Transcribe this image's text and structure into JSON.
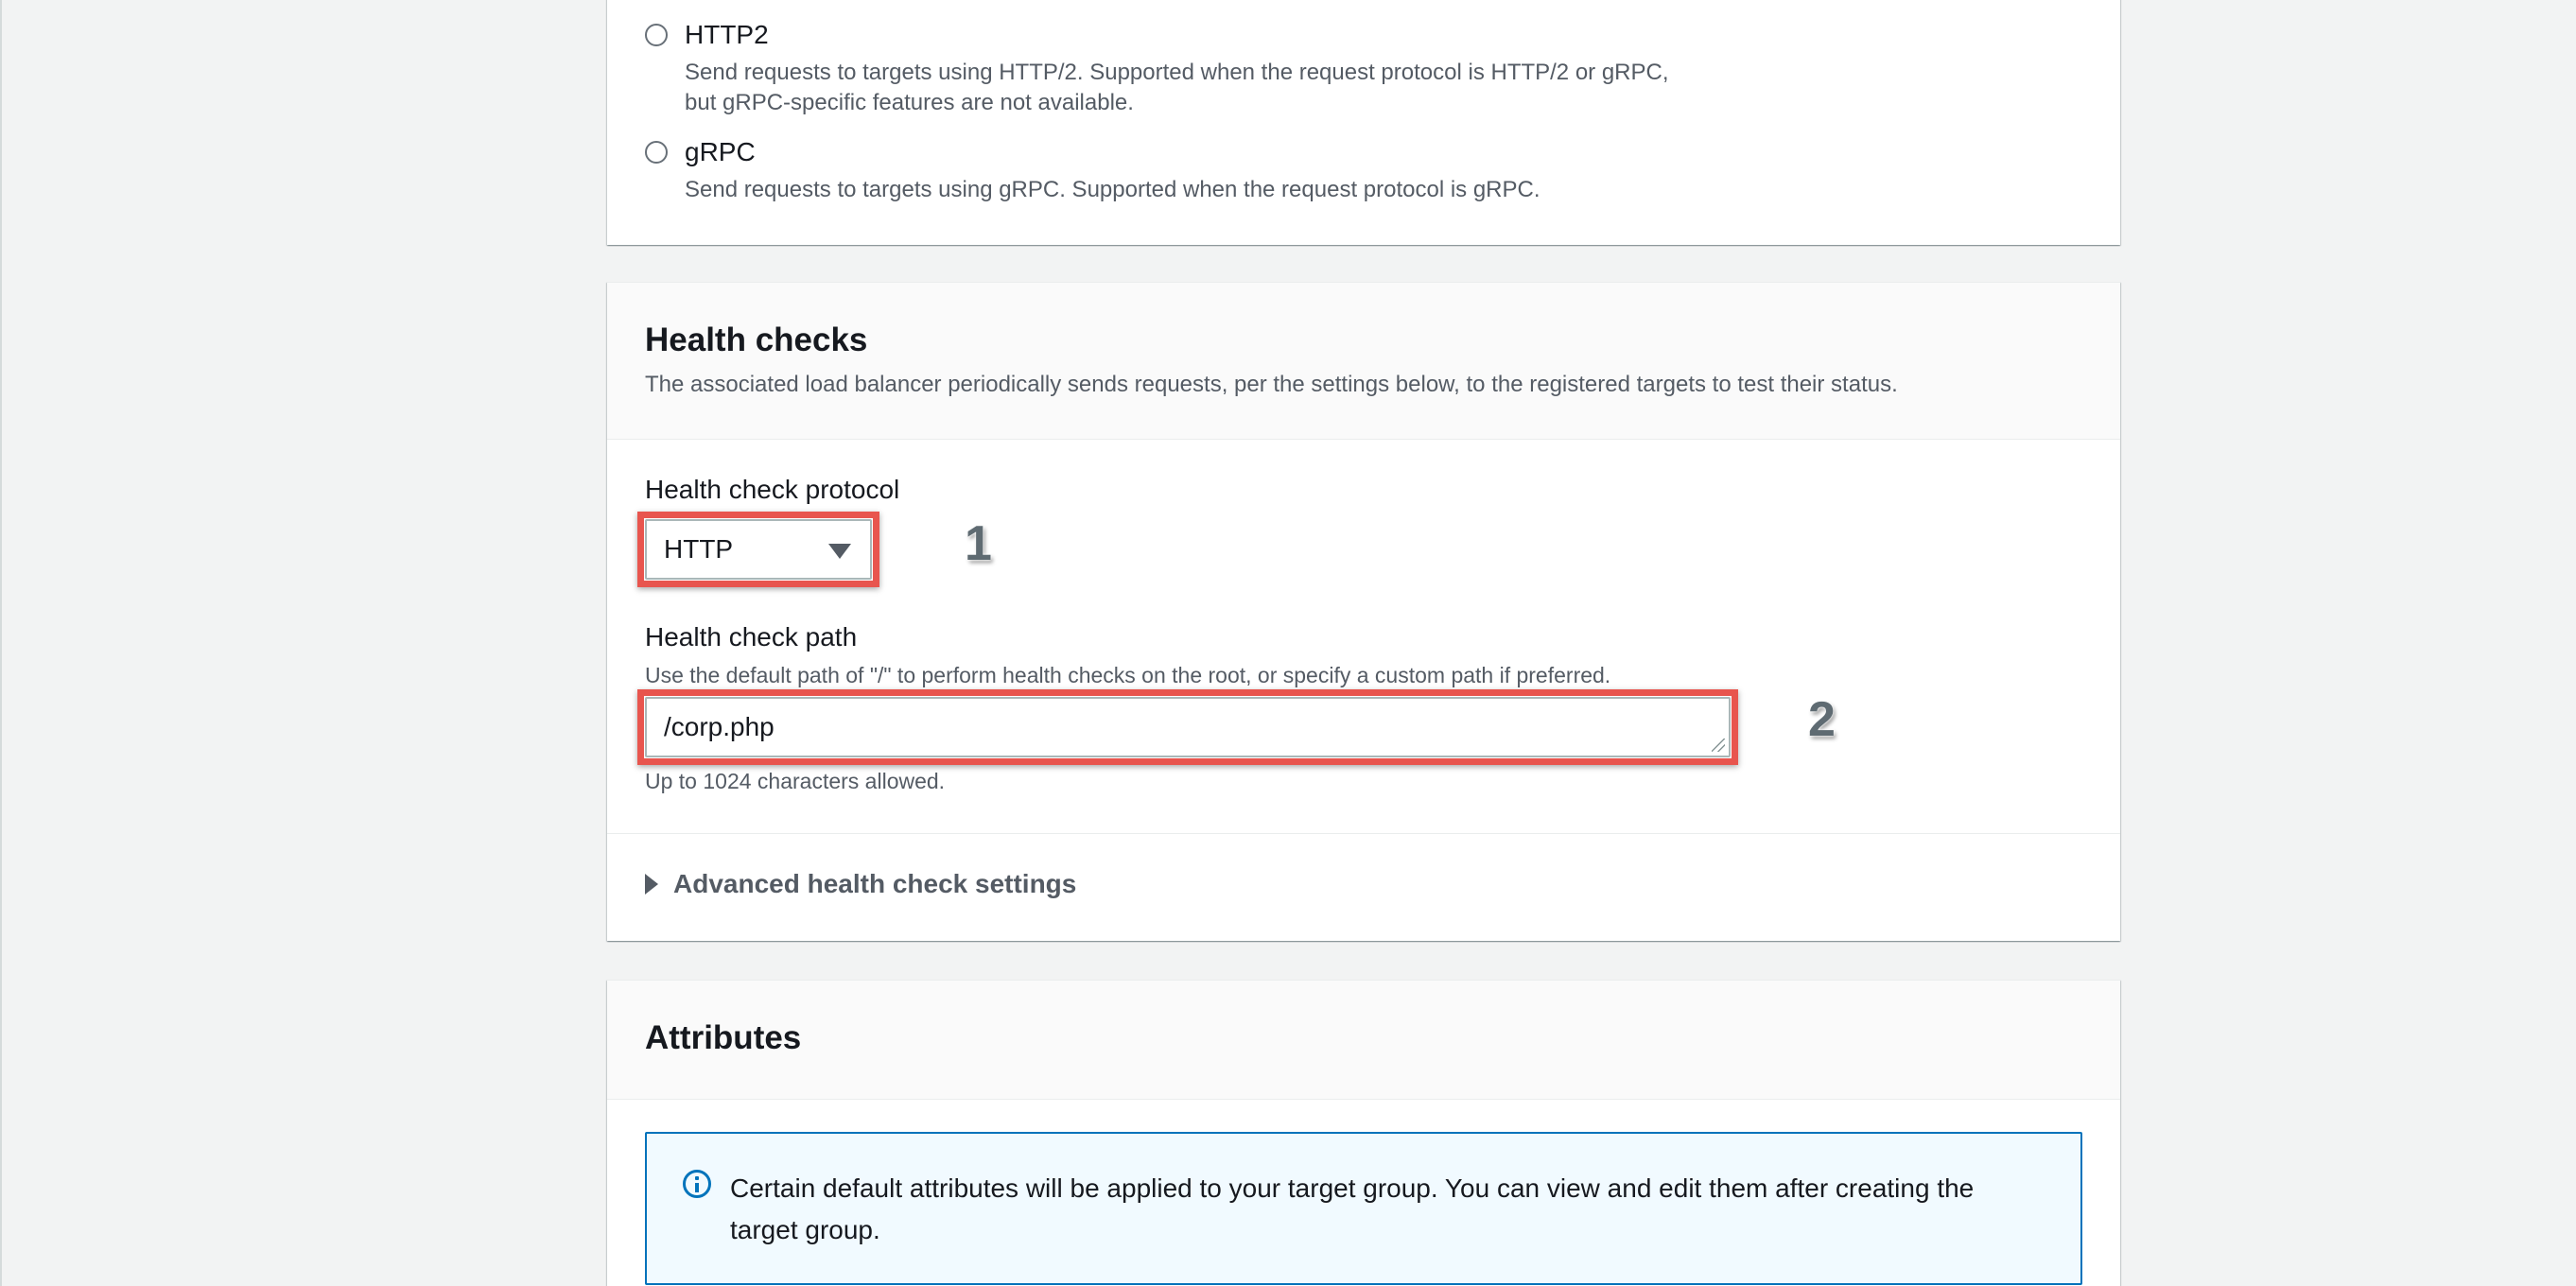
{
  "protocol_options": [
    {
      "label": "HTTP2",
      "description_line1": "Send requests to targets using HTTP/2. Supported when the request protocol is HTTP/2 or gRPC,",
      "description_line2": "but gRPC-specific features are not available."
    },
    {
      "label": "gRPC",
      "description_line1": "Send requests to targets using gRPC. Supported when the request protocol is gRPC."
    }
  ],
  "health_checks": {
    "title": "Health checks",
    "description": "The associated load balancer periodically sends requests, per the settings below, to the registered targets to test their status.",
    "protocol_label": "Health check protocol",
    "protocol_value": "HTTP",
    "path_label": "Health check path",
    "path_description": "Use the default path of \"/\" to perform health checks on the root, or specify a custom path if preferred.",
    "path_value": "/corp.php",
    "path_hint": "Up to 1024 characters allowed.",
    "advanced_label": "Advanced health check settings"
  },
  "annotations": {
    "step1": "1",
    "step2": "2",
    "color": "#e8554e"
  },
  "attributes": {
    "title": "Attributes",
    "info_text": "Certain default attributes will be applied to your target group. You can view and edit them after creating the target group."
  }
}
